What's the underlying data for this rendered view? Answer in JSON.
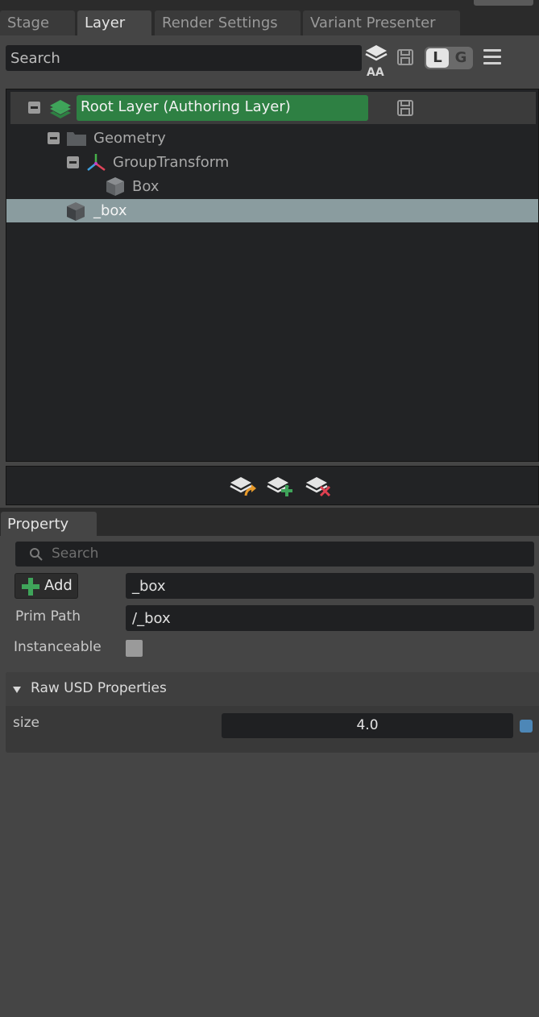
{
  "top_tabs": [
    "Stage",
    "Layer",
    "Render Settings",
    "Variant Presenter"
  ],
  "active_tab": "Layer",
  "layer_toolbar": {
    "search_placeholder": "Search",
    "aa_label": "AA",
    "toggle_l": "L",
    "toggle_g": "G"
  },
  "tree": {
    "root_label": "Root Layer (Authoring Layer)",
    "nodes": {
      "geometry": "Geometry",
      "group_transform": "GroupTransform",
      "box": "Box",
      "underscore_box": "_box"
    }
  },
  "property_panel": {
    "tab": "Property",
    "search_placeholder": "Search",
    "add_label": "Add",
    "name_value": "_box",
    "prim_path_label": "Prim Path",
    "prim_path_value": "/_box",
    "instanceable_label": "Instanceable",
    "instanceable_checked": false,
    "raw_section_title": "Raw USD Properties",
    "size_label": "size",
    "size_value": "4.0"
  },
  "colors": {
    "root_layer_bg": "#2e8043",
    "selected_row_bg": "#8a9c9f",
    "accent_blue": "#4d87b7"
  }
}
